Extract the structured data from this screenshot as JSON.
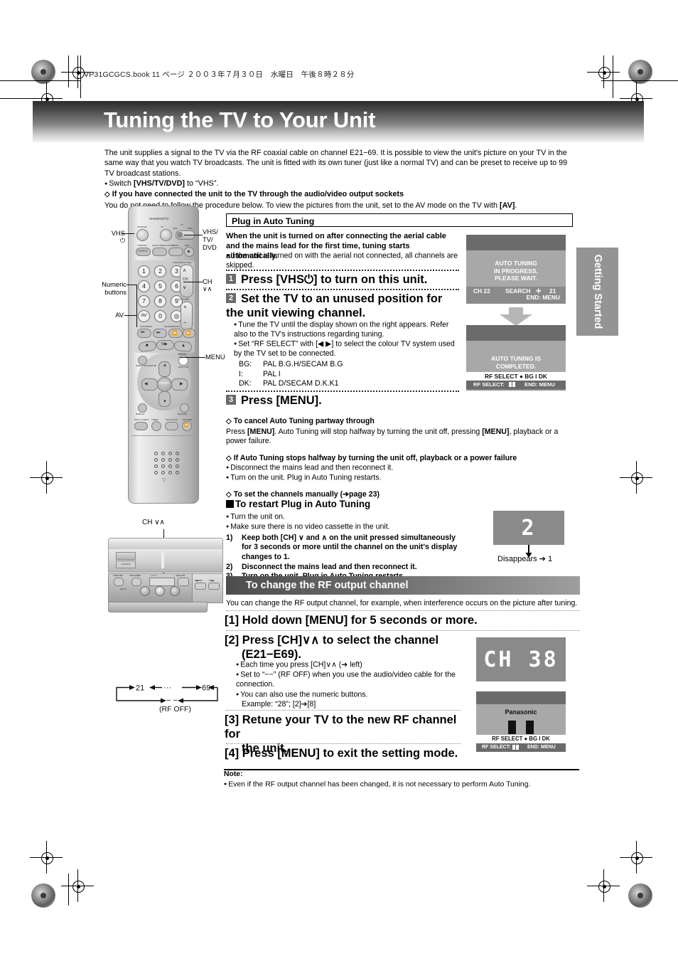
{
  "fileinfo": "VP31GCGCS.book  11 ページ  ２００３年７月３０日　水曜日　午後８時２８分",
  "banner": {
    "title": "Tuning the TV to Your Unit"
  },
  "sidetab": {
    "label": "Getting Started"
  },
  "intro": {
    "p1": "The unit supplies a signal to the TV via the RF coaxial cable on channel E21−69. It is possible to view the unit's picture on your TV in the same way that you watch TV broadcasts. The unit is fitted with its own tuner (just like a normal TV) and can be preset to receive up to 99 TV broadcast stations.",
    "bullet1_pre": "Switch ",
    "bullet1_bold": "[VHS/TV/DVD]",
    "bullet1_post": " to “VHS”.",
    "dia1": "If you have connected the unit to the TV through the audio/video output sockets",
    "p2_pre": "You do not need to follow the procedure below. To view the pictures from the unit, set to the AV mode on the TV with ",
    "p2_bold": "[AV]",
    "p2_post": "."
  },
  "plugin": {
    "heading": "Plug in Auto Tuning",
    "lead": "When the unit is turned on after connecting the aerial cable and the mains lead for the first time, tuning starts automatically.",
    "bullet": "If the unit is turned on with the aerial not connected, all channels are skipped.",
    "step1_num": "1",
    "step1_text": "Press [VHS⏻] to turn on this unit.",
    "step2_num": "2",
    "step2_text": "Set the TV to an unused position for the unit viewing channel.",
    "step2_b1": "Tune the TV until the display shown on the right appears. Refer also to the TV's instructions regarding tuning.",
    "step2_b2": "Set “RF SELECT” with [◀ ▶] to select the colour TV system used by the TV set to be connected.",
    "systems": [
      {
        "code": "BG:",
        "desc": "PAL B.G.H/SECAM B.G"
      },
      {
        "code": "I:",
        "desc": "PAL I"
      },
      {
        "code": "DK:",
        "desc": "PAL D/SECAM D.K.K1"
      }
    ],
    "step3_num": "3",
    "step3_text": "Press [MENU]."
  },
  "tv1": {
    "line1": "AUTO TUNING",
    "line2": "IN PROGRESS,",
    "line3": "PLEASE WAIT.",
    "osd_ch": "CH 22",
    "osd_search": "SEARCH",
    "osd_num": "21",
    "osd_end": "END: MENU"
  },
  "tv2": {
    "line1": "AUTO TUNING IS",
    "line2": "COMPLETED.",
    "osd_white": "RF SELECT   ● BG    I    DK",
    "osd_dark_left": "RF SELECT:",
    "osd_dark_right": "END: MENU"
  },
  "cancel": {
    "dia1": "To cancel Auto Tuning partway through",
    "p1_a": "Press ",
    "p1_menu": "[MENU]",
    "p1_b": ". Auto Tuning will stop halfway by turning the unit off, pressing ",
    "p1_menu2": "[MENU]",
    "p1_c": ", playback or a power failure.",
    "dia2": "If Auto Tuning stops halfway by turning the unit off, playback or a power failure",
    "b1": "Disconnect the mains lead and then reconnect it.",
    "b2": "Turn on the unit. Plug in Auto Tuning restarts.",
    "dia3": "To set the channels manually (➔page 23)"
  },
  "restart": {
    "heading": "To restart Plug in Auto Tuning",
    "b1": "Turn the unit on.",
    "b2": "Make sure there is no video cassette in the unit.",
    "items": [
      {
        "n": "1)",
        "text": "Keep both [CH] ∨ and ∧ on the unit pressed simultaneously for 3 seconds or more until the channel on the unit's display changes to 1."
      },
      {
        "n": "2)",
        "text": "Disconnect the mains lead and then reconnect it."
      },
      {
        "n": "3)",
        "text": "Turn on the unit. Plug in Auto Tuning restarts."
      }
    ],
    "fl_value": "2",
    "disappears": "Disappears ➔ 1"
  },
  "rfsection": {
    "heading": "To change the RF output channel",
    "intro": "You can change the RF output channel, for example, when interference occurs on the picture after tuning.",
    "s1": "[1] Hold down [MENU] for 5 seconds or more.",
    "s2_l1": "[2] Press [CH]∨∧ to select the channel",
    "s2_l2": "(E21−E69).",
    "s2_b1": "Each time you press [CH]∨∧ (➔ left)",
    "s2_b2": "Set to “−−” (RF OFF) when you use the audio/video cable for the connection.",
    "s2_b3": "You can also use the numeric buttons.",
    "s2_b3_ex": "Example: “28”; [2]➔[8]",
    "s3_l1": "[3] Retune your TV to the new RF channel for",
    "s3_l2": "the unit.",
    "s4": "[4] Press [MENU] to exit the setting mode."
  },
  "fl_ch": {
    "value": "CH 38"
  },
  "tv3": {
    "brand": "Panasonic",
    "osd_white": "RF SELECT   ● BG    I    DK",
    "osd_dark_left": "RF SELECT:",
    "osd_dark_right": "END: MENU"
  },
  "cycle": {
    "left": "21",
    "dots": "···",
    "right": "69",
    "dash": "− −",
    "rfoff": "(RF OFF)"
  },
  "note": {
    "label": "Note:",
    "text": "Even if the RF output channel has been changed, it is not necessary to perform Auto Tuning."
  },
  "remote": {
    "top_label": "VHS/DVD/TV",
    "btn_vhsdvd": "VHS/DVD",
    "btn_tv": "TV",
    "sw_tv": "TV",
    "sw_vhs": "VHS",
    "sw_dvd": "DVD",
    "btn_output": "OUTPUT",
    "lbl_vhsdvd2": "VHS/DVD",
    "lbl_quickreplay": "QUICK REPLAY",
    "lbl_dubbing": "DUBBING",
    "lbl_rec": "REC",
    "lbl_tracking": "TRACKING/V-LOCK",
    "lbl_ch": "CH",
    "lbl_volume": "VOLUME",
    "lbl_skip": "SKIP/INDEX",
    "lbl_slowsearch": "SLOW/SEARCH",
    "lbl_av": "AV",
    "lbl_enter": "ENTER",
    "lbl_menu": "MENU",
    "lbl_display": "DISPLAY",
    "lbl_return": "RETURN",
    "lbl_progcheck": "PROG CHECK",
    "lbl_timer": "TIMER",
    "lbl_progplay": "PROG PLAY",
    "lbl_jetrew": "JET REW",
    "lbl_directnav": "DIRECT NAVIGATOR",
    "lbl_playlist": "PLAY LIST",
    "keys": [
      "1",
      "2",
      "3",
      "4",
      "5",
      "6",
      "7",
      "8",
      "9",
      "0"
    ]
  },
  "callouts": {
    "vhs": "VHS",
    "vhs_power": "⏻",
    "numeric": "Numeric\nbuttons",
    "av": "AV",
    "vhstvdvd": "VHS/\nTV/\nDVD",
    "ch": "CH",
    "ch_arrows": "∨∧",
    "menu": "MENU",
    "unit_ch": "CH ∨∧"
  }
}
